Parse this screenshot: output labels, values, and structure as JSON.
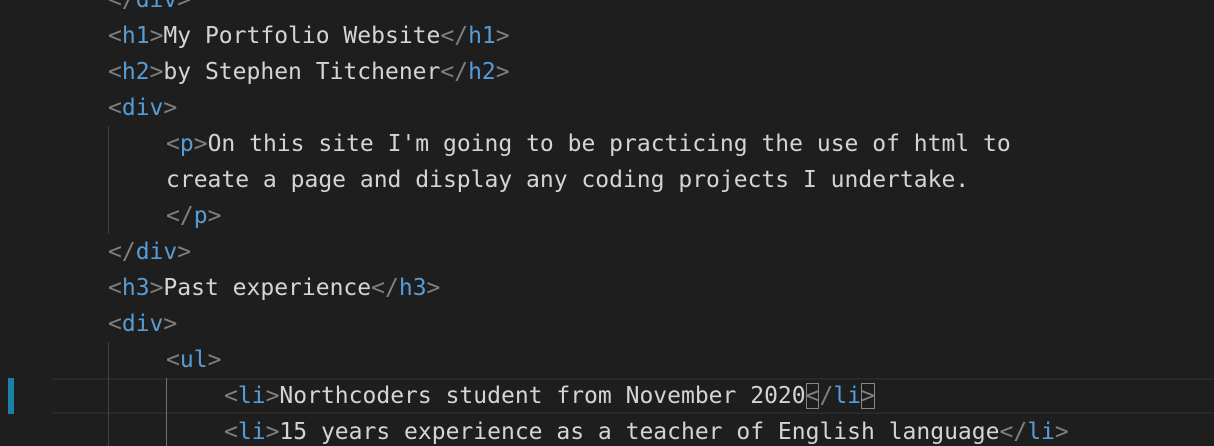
{
  "lines": [
    {
      "tag": "div",
      "closing_only": true
    },
    {
      "open": "h1",
      "text": "My Portfolio Website",
      "close": "h1"
    },
    {
      "open": "h2",
      "text": "by Stephen Titchener",
      "close": "h2"
    },
    {
      "open": "div"
    },
    {
      "open": "p",
      "text": "On this site I'm going to be practicing the use of html to"
    },
    {
      "text": "create a page and display any coding projects I undertake."
    },
    {
      "close": "p"
    },
    {
      "close": "div"
    },
    {
      "open": "h3",
      "text": "Past experience",
      "close": "h3"
    },
    {
      "open": "div"
    },
    {
      "open": "ul"
    },
    {
      "open": "li",
      "text": "Northcoders student from November 2020",
      "close": "li"
    },
    {
      "open": "li",
      "text": "15 years experience as a teacher of English language",
      "close": "li"
    }
  ],
  "colors": {
    "background": "#1e1e1e",
    "punctuation": "#808080",
    "tag": "#569cd6",
    "text": "#d4d4d4",
    "gutter_modified": "#1b81a8"
  }
}
